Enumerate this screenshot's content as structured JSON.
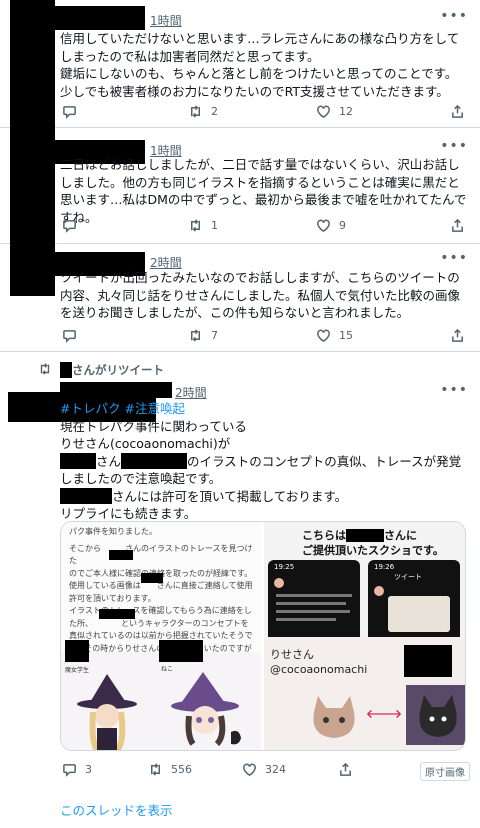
{
  "tweets": [
    {
      "time": "1時間",
      "text": "信用していただけないと思います…ラレ元さんにあの様な凸り方をしてしまったので私は加害者同然だと思ってます。\n鍵垢にしないのも、ちゃんと落とし前をつけたいと思ってのことです。\n少しでも被害者様のお力になりたいのでRT支援させていただきます。",
      "retweets": "2",
      "likes": "12"
    },
    {
      "time": "1時間",
      "text": "二日ほどお話ししましたが、二日で話す量ではないくらい、沢山お話ししました。他の方も同じイラストを指摘するということは確実に黒だと思います…私はDMの中でずっと、最初から最後まで嘘を吐かれてたんですね。",
      "retweets": "1",
      "likes": "9"
    },
    {
      "time": "2時間",
      "text": "ツイートが出回ったみたいなのでお話ししますが、こちらのツイートの内容、丸々同じ話をりせさんにしました。私個人で気付いた比較の画像を送りお聞きしましたが、この件も知らないと言われました。",
      "retweets": "7",
      "likes": "15"
    }
  ],
  "retweet_tweet": {
    "retweeted_by": "さんがリツイート",
    "time": "2時間",
    "hashtag1": "#トレパク",
    "hashtag2": "#注意喚起",
    "line1": "現在トレパク事件に関わっている",
    "line2": "りせさん(cocoaonomachi)が",
    "line3a": "さん",
    "line3b": "のイラストのコンセプトの真似、トレースが発覚しましたので注意喚起です。",
    "line4": "さんには許可を頂いて掲載しております。",
    "line5": "リプライにも続きます。",
    "replies": "3",
    "retweets": "556",
    "likes": "324",
    "media_badge": "原寸画像",
    "show_thread": "このスレッドを表示",
    "media": {
      "left_text": [
        "パク事件を知りました。",
        "そこから　　　さんのイラストのトレースを見つけた",
        "のでご本人様に確認の連絡を取ったのが経緯です。",
        "使用している画像は　　さんに直接ご連絡して使用",
        "許可を頂いております。",
        "イラストのトレースを確認してもらう為に連絡をし",
        "た所、　　　　というキャラクターのコンセプトを",
        "真似されているのは以前から把握されていたそうで",
        "す。その時からりせさんの事は知っていたのですが特"
      ],
      "right_heading_a": "こちらは",
      "right_heading_b": "さんに",
      "right_heading_c": "ご提供頂いたスクショです。",
      "phone_left_time": "19:25",
      "phone_right_time": "19:26",
      "phone_right_title": "ツイート",
      "label_witch": "魔女学生",
      "label_cat": "ねこ",
      "br_line1": "りせさん",
      "br_line2": "@cocoaonomachi"
    }
  }
}
